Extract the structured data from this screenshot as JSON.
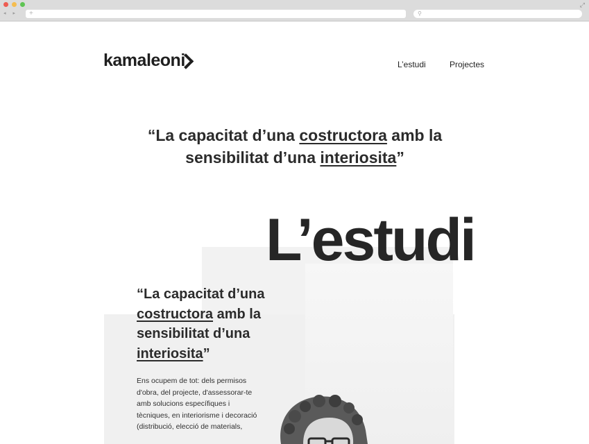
{
  "browser": {
    "nav_arrows": "◂ ▸",
    "new_tab": "+",
    "search_icon": "search-icon"
  },
  "header": {
    "logo_text": "kamaleoni",
    "nav": [
      {
        "label": "L’estudi"
      },
      {
        "label": "Projectes"
      }
    ]
  },
  "hero": {
    "quote_open": "“La capacitat d’una ",
    "quote_u1": "costructora",
    "quote_mid": "  amb la sensibilitat d’una ",
    "quote_u2": "interiosita",
    "quote_close": "”"
  },
  "section": {
    "title": "L’estudi",
    "quote_open": "“La capacitat d’una ",
    "quote_u1": "costructora",
    "quote_mid": "  amb la sensibilitat d’una ",
    "quote_u2": "interiosita",
    "quote_close": "”",
    "body": "Ens ocupem de tot: dels permisos d'obra, del projecte, d'assessorar-te amb solucions específiques i tècniques, en interiorisme i decoració (distribució, elecció de materials,"
  },
  "colors": {
    "accent": "#2b2b2b",
    "photo_bg": "#f2f2f2"
  }
}
